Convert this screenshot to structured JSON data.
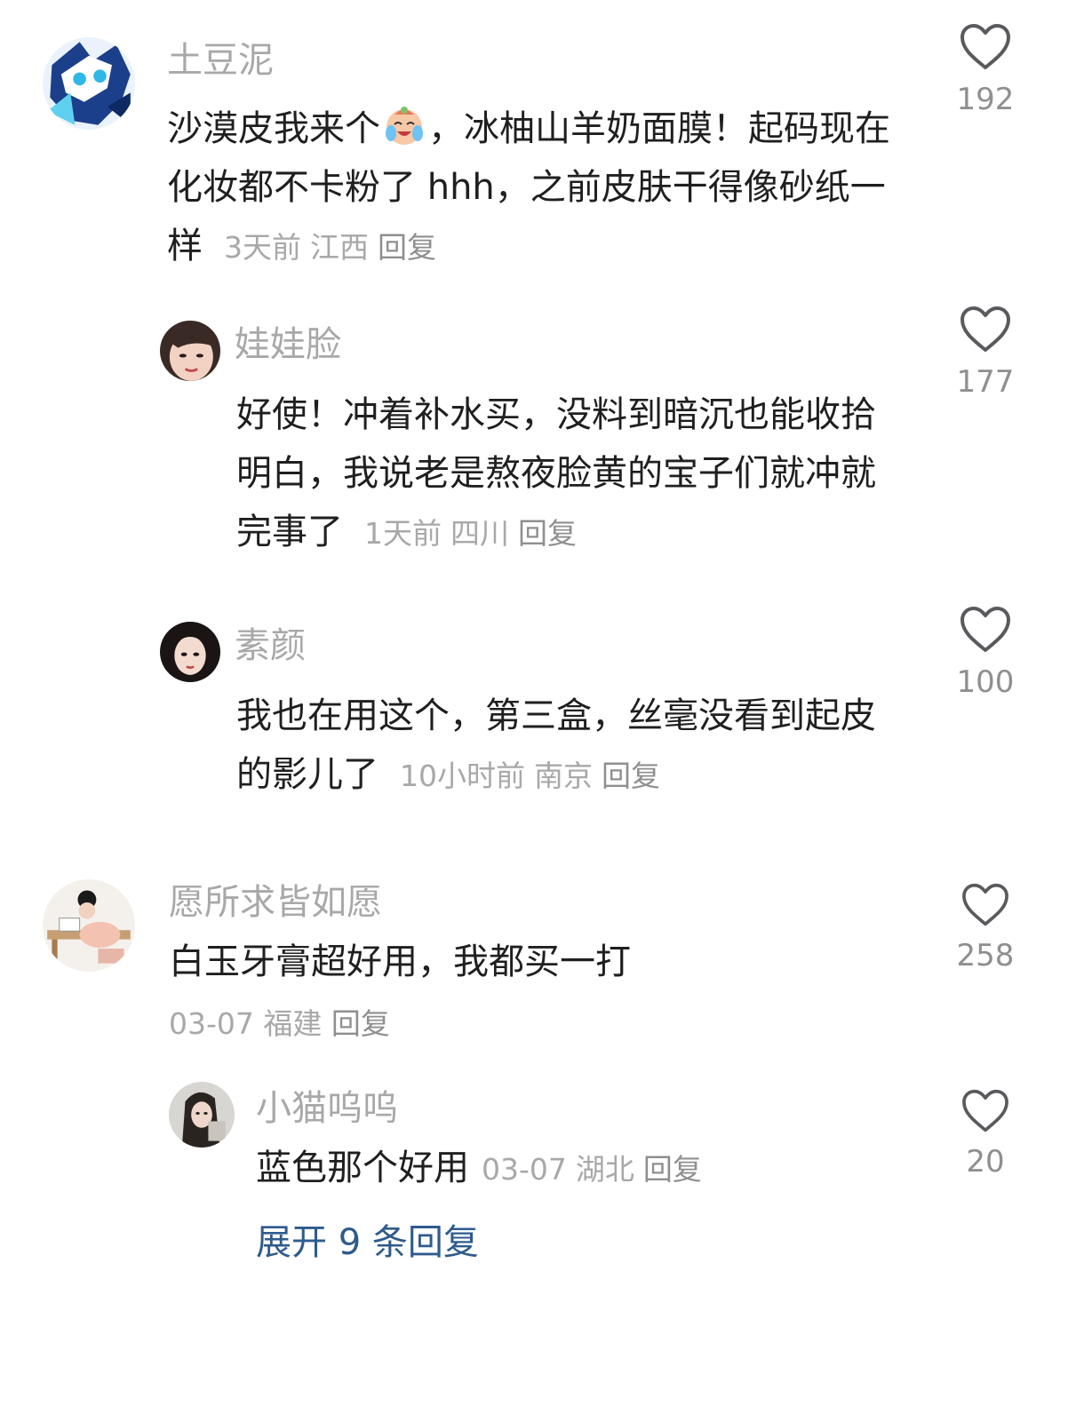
{
  "comments": [
    {
      "username": "土豆泥",
      "text_before_emoji": "沙漠皮我来个",
      "emoji": "crying-laughing-emoji",
      "text_after_emoji": "，冰柚山羊奶面膜！起码现在化妆都不卡粉了 hhh，之前皮肤干得像砂纸一样",
      "time": "3天前",
      "location": "江西",
      "reply_label": "回复",
      "likes": "192"
    },
    {
      "username": "娃娃脸",
      "text": "好使！冲着补水买，没料到暗沉也能收拾明白，我说老是熬夜脸黄的宝子们就冲就完事了",
      "time": "1天前",
      "location": "四川",
      "reply_label": "回复",
      "likes": "177"
    },
    {
      "username": "素颜",
      "text": "我也在用这个，第三盒，丝毫没看到起皮的影儿了",
      "time": "10小时前",
      "location": "南京",
      "reply_label": "回复",
      "likes": "100"
    },
    {
      "username": "愿所求皆如愿",
      "text": "白玉牙膏超好用，我都买一打",
      "time": "03-07",
      "location": "福建",
      "reply_label": "回复",
      "likes": "258"
    },
    {
      "username": "小猫呜呜",
      "text": "蓝色那个好用",
      "time": "03-07",
      "location": "湖北",
      "reply_label": "回复",
      "likes": "20"
    }
  ],
  "expand_replies": "展开 9 条回复",
  "colors": {
    "username": "#a8a8aa",
    "comment_text": "#1f1f1f",
    "meta": "#a8a8aa",
    "expand_link": "#2f5b8c",
    "heart_outline": "#5a5a5e"
  }
}
